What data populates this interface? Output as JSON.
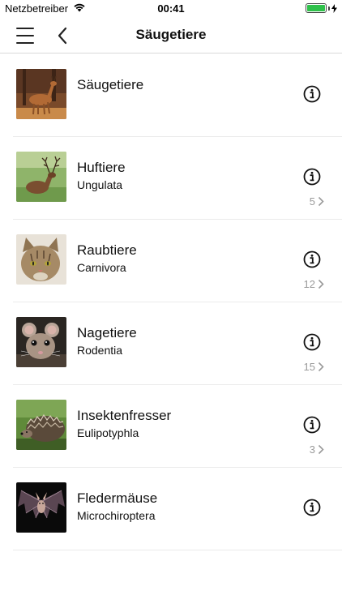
{
  "status_bar": {
    "carrier": "Netzbetreiber",
    "time": "00:41"
  },
  "nav": {
    "title": "Säugetiere"
  },
  "items": [
    {
      "title": "Säugetiere",
      "subtitle": "",
      "count": "",
      "image": "roe-deer"
    },
    {
      "title": "Huftiere",
      "subtitle": "Ungulata",
      "count": "5",
      "image": "red-deer"
    },
    {
      "title": "Raubtiere",
      "subtitle": "Carnivora",
      "count": "12",
      "image": "wildcat"
    },
    {
      "title": "Nagetiere",
      "subtitle": "Rodentia",
      "count": "15",
      "image": "mouse"
    },
    {
      "title": "Insektenfresser",
      "subtitle": "Eulipotyphla",
      "count": "3",
      "image": "hedgehog"
    },
    {
      "title": "Fledermäuse",
      "subtitle": "Microchiroptera",
      "count": "",
      "image": "bat"
    }
  ],
  "colors": {
    "battery": "#2fc14b",
    "separator": "#ebebeb",
    "count_text": "#9a9a9a"
  }
}
